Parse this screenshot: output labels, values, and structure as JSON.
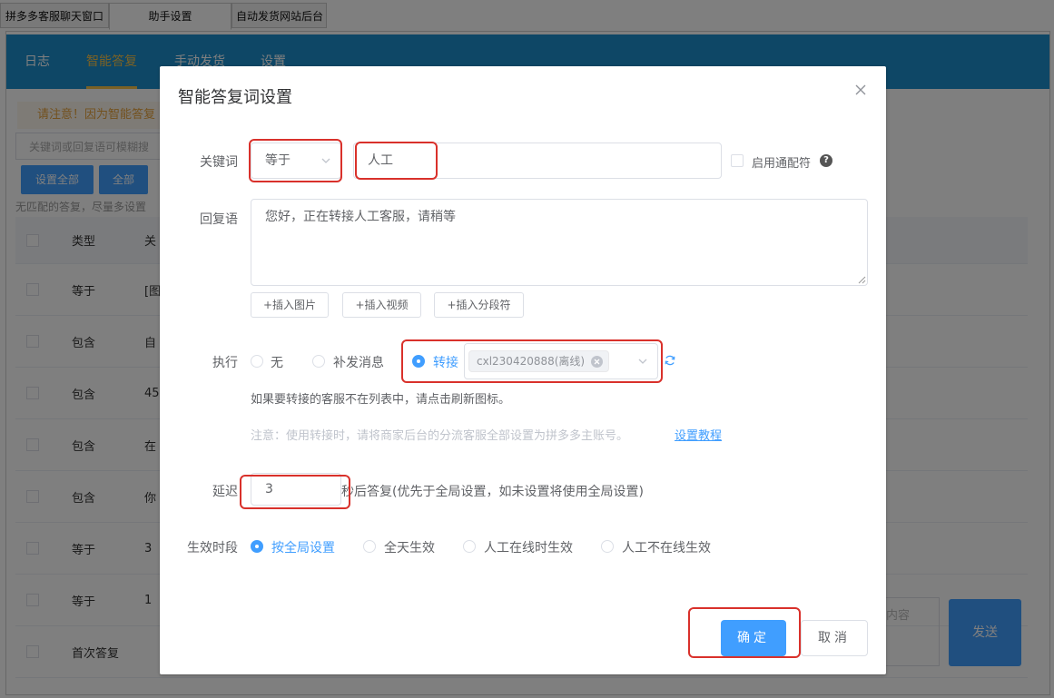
{
  "window_tabs": [
    "拼多多客服聊天窗口",
    "助手设置",
    "自动发货网站后台"
  ],
  "app_nav": {
    "items": [
      "日志",
      "智能答复",
      "手动发货",
      "设置"
    ],
    "active": "智能答复",
    "accent": "#1c8ecc"
  },
  "background": {
    "notice": "请注意！因为智能答复",
    "search_placeholder": "关键词或回复语可模糊搜",
    "btn_set_all": "设置全部",
    "btn_all": "全部",
    "hint": "无匹配的答复，尽量多设置",
    "table_headers": [
      "类型",
      "关"
    ],
    "rows": [
      {
        "type": "等于",
        "keyword": "[图"
      },
      {
        "type": "包含",
        "keyword": "自"
      },
      {
        "type": "包含",
        "keyword": "45"
      },
      {
        "type": "包含",
        "keyword": "在"
      },
      {
        "type": "包含",
        "keyword": "你"
      },
      {
        "type": "等于",
        "keyword": "3"
      },
      {
        "type": "等于",
        "keyword": "1"
      },
      {
        "type": "首次答复",
        "keyword": ""
      }
    ],
    "send_placeholder": "内容",
    "send_label": "发送"
  },
  "dialog": {
    "title": "智能答复词设置",
    "keyword": {
      "label": "关键词",
      "match_type": "等于",
      "value": "人工",
      "wildcard_label": "启用通配符",
      "help": "?"
    },
    "reply": {
      "label": "回复语",
      "value": "您好，正在转接人工客服，请稍等",
      "insert_buttons": [
        "+插入图片",
        "+插入视频",
        "+插入分段符"
      ]
    },
    "execute": {
      "label": "执行",
      "options": [
        "无",
        "补发消息",
        "转接"
      ],
      "selected": "转接",
      "transfer_target": "cxl230420888(离线)",
      "tip": "如果要转接的客服不在列表中，请点击刷新图标。",
      "note": "注意：使用转接时，请将商家后台的分流客服全部设置为拼多多主账号。",
      "tutorial_link": "设置教程"
    },
    "delay": {
      "label": "延迟",
      "value": "3",
      "suffix": "秒后答复(优先于全局设置，如未设置将使用全局设置)"
    },
    "effective": {
      "label": "生效时段",
      "options": [
        "按全局设置",
        "全天生效",
        "人工在线时生效",
        "人工不在线生效"
      ],
      "selected": "按全局设置"
    },
    "confirm_label": "确定",
    "cancel_label": "取消",
    "primary_color": "#409eff",
    "highlight_color": "#d9312b"
  }
}
